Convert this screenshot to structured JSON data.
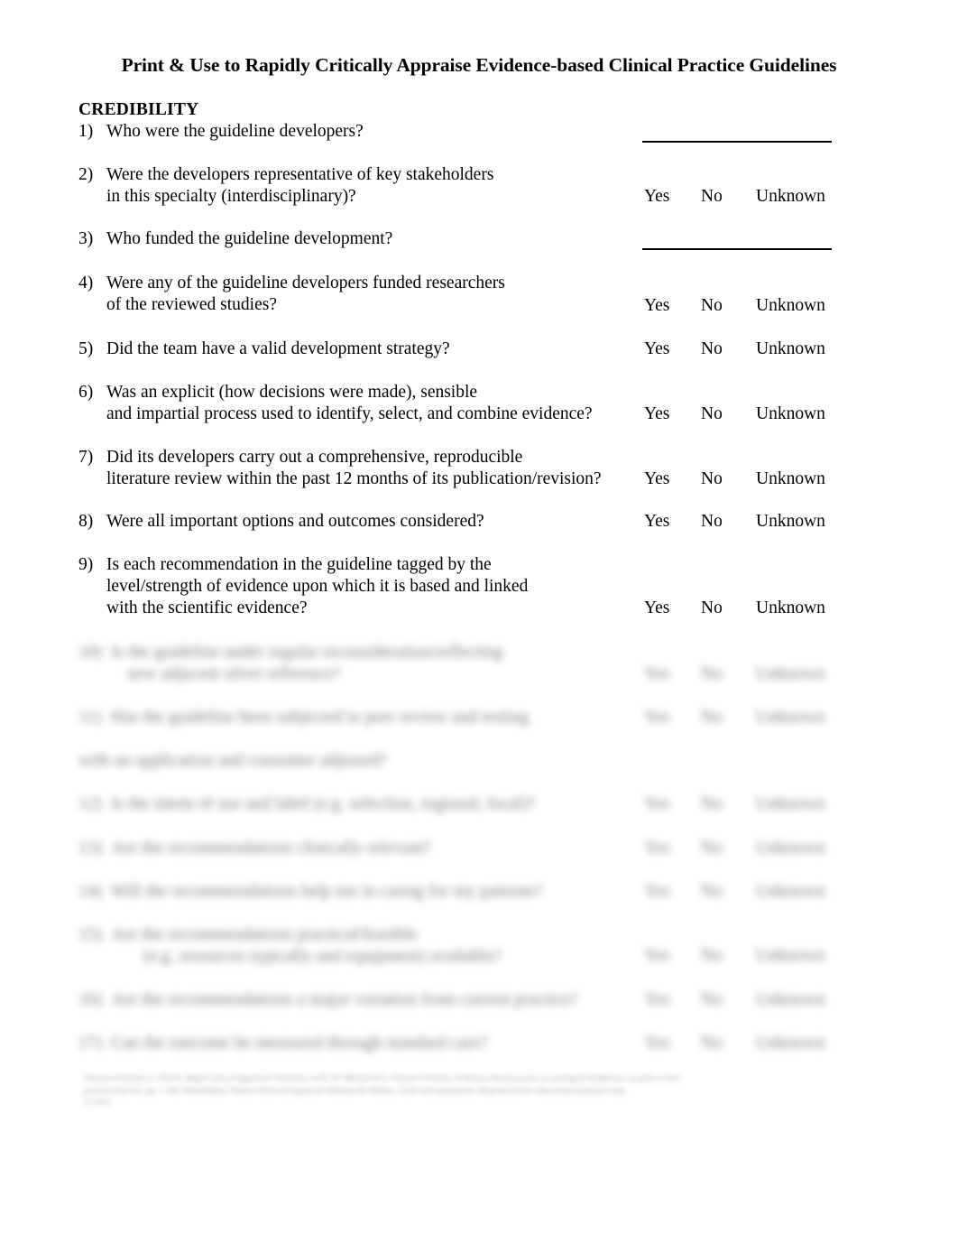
{
  "document": {
    "title": "Print & Use to Rapidly Critically Appraise Evidence-based Clinical Practice Guidelines",
    "section_heading": "CREDIBILITY"
  },
  "answers": {
    "yes": "Yes",
    "no": "No",
    "unknown": "Unknown"
  },
  "questions": [
    {
      "number": "1)",
      "line1": "Who were the guideline developers?",
      "line2": "",
      "line3": "",
      "answer_type": "blank",
      "blurred": false
    },
    {
      "number": "2)",
      "line1": "Were the developers representative of key stakeholders",
      "line2": "in this specialty (interdisciplinary)?",
      "line3": "",
      "answer_type": "choices",
      "blurred": false
    },
    {
      "number": "3)",
      "line1": "Who funded the guideline development?",
      "line2": "",
      "line3": "",
      "answer_type": "blank",
      "blurred": false
    },
    {
      "number": "4)",
      "line1": "Were any of the guideline developers funded researchers",
      "line2": "of the reviewed studies?",
      "line3": "",
      "answer_type": "choices",
      "blurred": false
    },
    {
      "number": "5)",
      "line1": "Did the team have a valid development strategy?",
      "line2": "",
      "line3": "",
      "answer_type": "choices",
      "blurred": false
    },
    {
      "number": "6)",
      "line1": "Was an explicit (how decisions were made),  sensible",
      "line2": "and impartial process used to identify, select, and combine evidence?",
      "line3": "",
      "answer_type": "choices",
      "blurred": false
    },
    {
      "number": "7)",
      "line1": "Did its developers carry out a comprehensive, reproducible",
      "line2": "literature review within the past 12 months of its publication/revision?",
      "line3": "",
      "answer_type": "choices",
      "blurred": false
    },
    {
      "number": "8)",
      "line1": "Were all important options and outcomes considered?",
      "line2": "",
      "line3": "",
      "answer_type": "choices",
      "blurred": false
    },
    {
      "number": "9)",
      "line1": "Is each recommendation in the guideline tagged by the",
      "line2": "level/strength of evidence upon which it is based and linked",
      "line3": "with the scientific evidence?",
      "answer_type": "choices",
      "blurred": false
    }
  ],
  "obscured_questions": [
    {
      "number": "10)",
      "line1": "Is the guideline under regular reconsideration/reflecting",
      "line2": "new adjacent silver reference?",
      "line3": "",
      "answer_type": "choices",
      "blurred": true
    },
    {
      "number": "11)",
      "line1": "Has the guideline been subjected to peer review and testing",
      "line2": "",
      "line3": "",
      "answer_type": "choices",
      "blurred": true
    },
    {
      "number": "",
      "line1": "with an application and consumer adjusted?",
      "line2": "",
      "line3": "",
      "answer_type": "none",
      "blurred": true
    },
    {
      "number": "12)",
      "line1": "Is the intent of use and label (e.g. selection, regional, local)?",
      "line2": "",
      "line3": "",
      "answer_type": "choices",
      "blurred": true
    },
    {
      "number": "13)",
      "line1": "Are the recommendations clinically relevant?",
      "line2": "",
      "line3": "",
      "answer_type": "choices",
      "blurred": true
    },
    {
      "number": "14)",
      "line1": "Will the recommendations help me in caring for my patients?",
      "line2": "",
      "line3": "",
      "answer_type": "choices",
      "blurred": true
    },
    {
      "number": "15)",
      "line1": "Are the recommendations practical/feasible",
      "line2": "(e.g. resources typically and equipment) available?",
      "line3": "",
      "answer_type": "choices",
      "blurred": true
    },
    {
      "number": "16)",
      "line1": "Are the recommendations a major variation from current practice?",
      "line2": "",
      "line3": "",
      "answer_type": "choices",
      "blurred": true
    },
    {
      "number": "17)",
      "line1": "Can the outcome be measured through standard care?",
      "line2": "",
      "line3": "",
      "answer_type": "choices",
      "blurred": true
    }
  ],
  "footnote": {
    "line1": "Fineout-Overholt, E. (2010). Rapid Critical Appraisal Checklists. In B. M. Melnyk & E. Fineout-Overholt, Evidence-based practice in nursing & healthcare: A guide to best",
    "line2": "practice (2nd ed., pp. 1-18). Philadelphia: Wolters Kluwer/Lippincott Williams & Wilkins. Used with permission. Reproduced for educational purposes only.",
    "line3": "© 2010"
  }
}
